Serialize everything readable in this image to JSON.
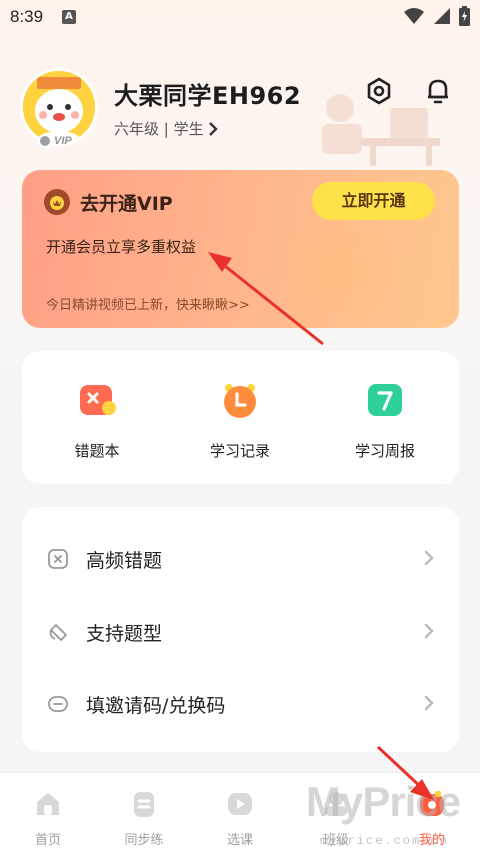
{
  "status_bar": {
    "time": "8:39",
    "notif_letter": "A"
  },
  "profile": {
    "username": "大栗同学EH962",
    "grade": "六年级 | 学生",
    "vip_badge": "VIP"
  },
  "vip_card": {
    "title": "去开通VIP",
    "subtitle": "开通会员立享多重权益",
    "promo": "今日精讲视频已上新，快来瞅瞅>>",
    "button": "立即开通"
  },
  "tools": [
    {
      "label": "错题本"
    },
    {
      "label": "学习记录"
    },
    {
      "label": "学习周报"
    }
  ],
  "menu": [
    {
      "label": "高频错题"
    },
    {
      "label": "支持题型"
    },
    {
      "label": "填邀请码/兑换码"
    }
  ],
  "tabs": [
    {
      "label": "首页"
    },
    {
      "label": "同步练"
    },
    {
      "label": "选课"
    },
    {
      "label": "班级"
    },
    {
      "label": "我的"
    }
  ],
  "watermark": {
    "main": "MyPrice",
    "sub": "myprice.com.cn"
  },
  "colors": {
    "accent": "#ff5a3c",
    "vip_button": "#ffe24a",
    "arrow": "#e8322a"
  }
}
